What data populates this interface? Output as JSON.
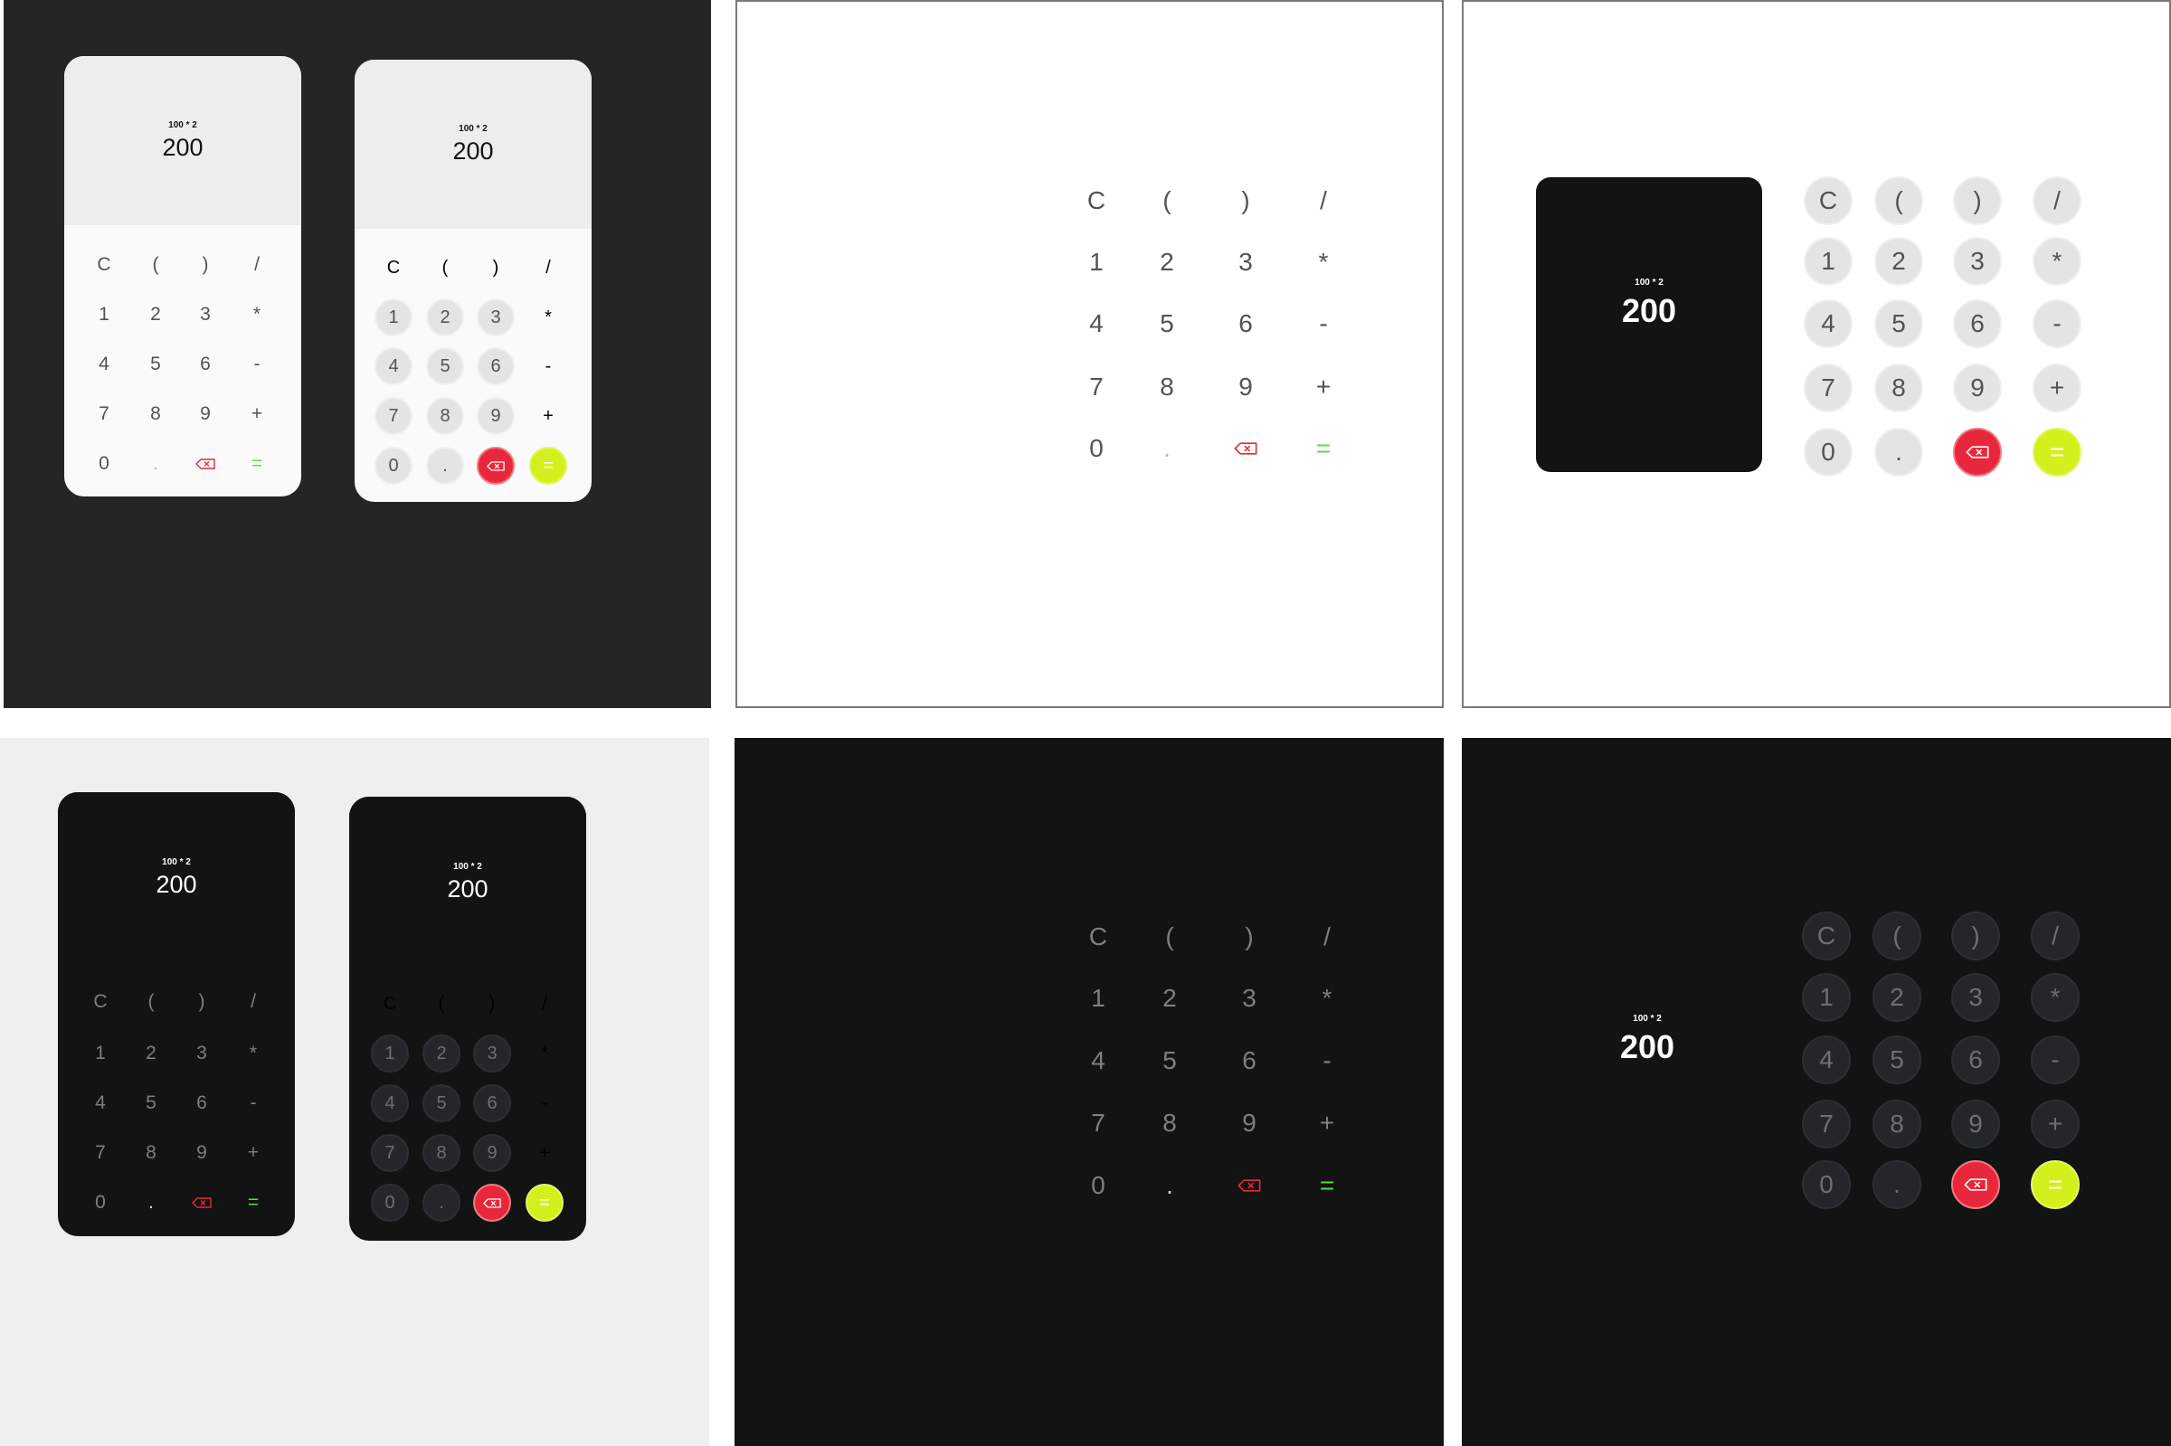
{
  "display": {
    "expression": "100 * 2",
    "result": "200"
  },
  "keypad": {
    "rows": [
      [
        "C",
        "(",
        ")",
        "/"
      ],
      [
        "1",
        "2",
        "3",
        "*"
      ],
      [
        "4",
        "5",
        "6",
        "-"
      ],
      [
        "7",
        "8",
        "9",
        "+"
      ],
      [
        "0",
        ".",
        "backspace-icon",
        "="
      ]
    ]
  },
  "colors": {
    "dark_bg": "#121414",
    "light_display": "#ecedec",
    "light_bg": "#fafafa",
    "delete_red": "#e8283a",
    "equals_yellow": "#d4f01c",
    "equals_green": "#5fd84a"
  }
}
